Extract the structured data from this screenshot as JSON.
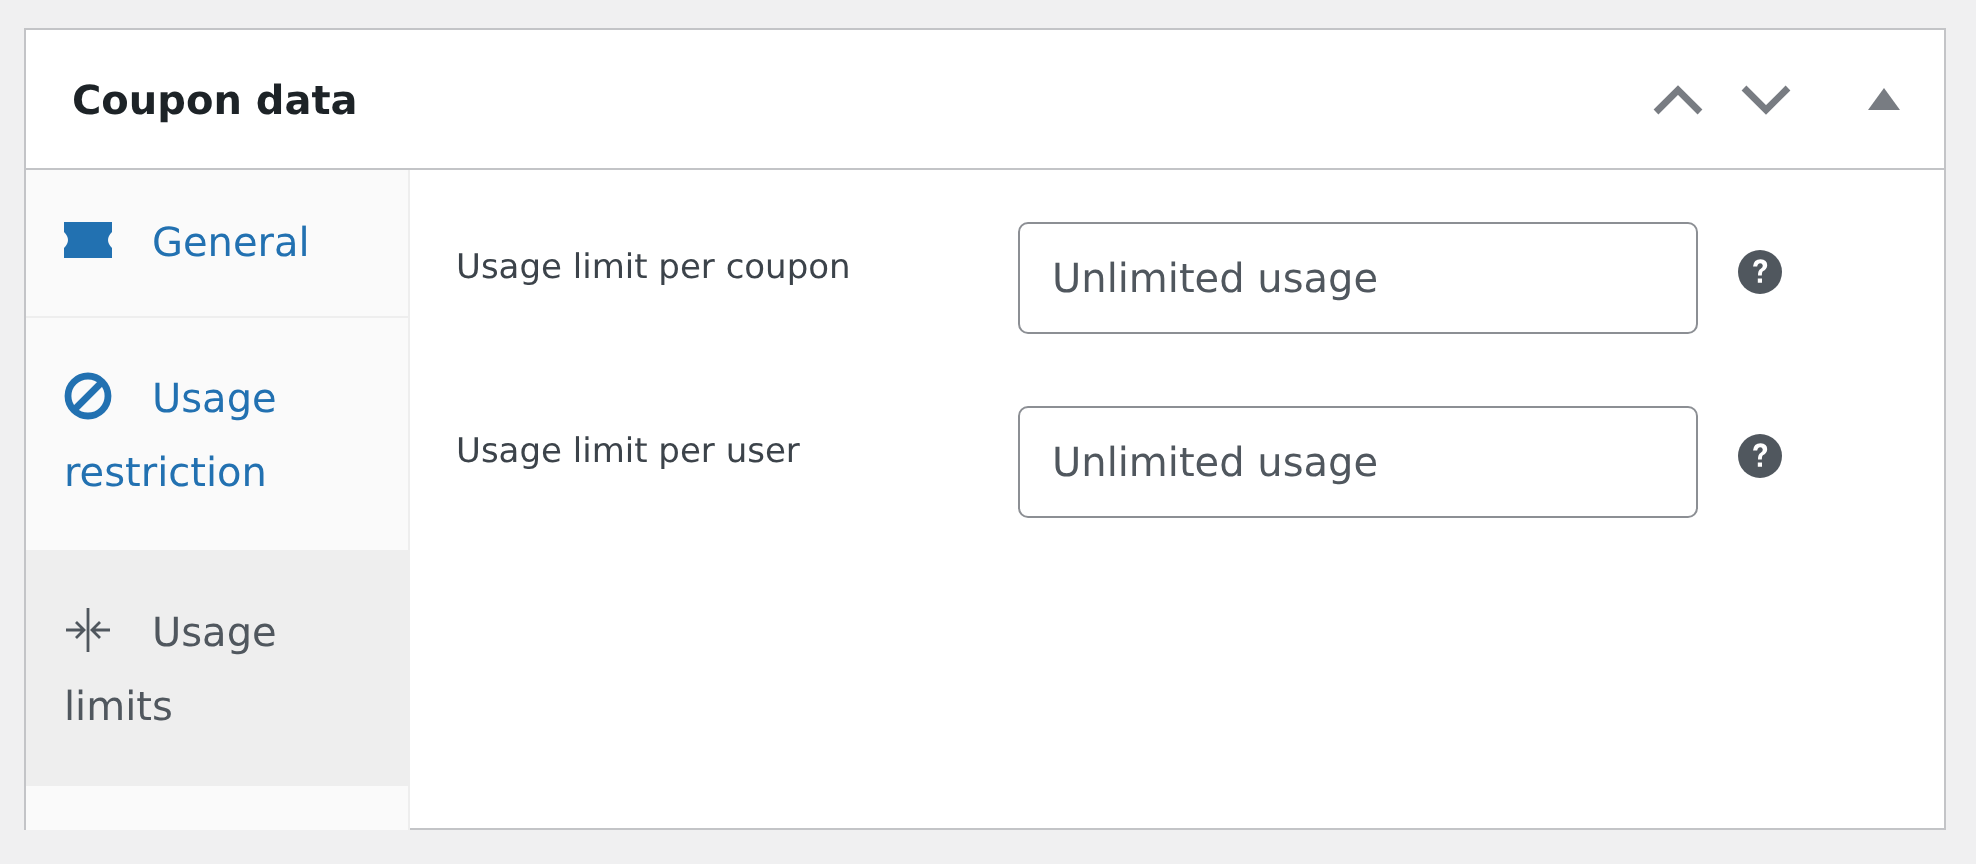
{
  "panel": {
    "title": "Coupon data"
  },
  "tabs": [
    {
      "label": "General",
      "selected": false
    },
    {
      "label": "Usage restriction",
      "selected": false
    },
    {
      "label": "Usage limits",
      "selected": true
    }
  ],
  "fields": [
    {
      "label": "Usage limit per coupon",
      "placeholder": "Unlimited usage"
    },
    {
      "label": "Usage limit per user",
      "placeholder": "Unlimited usage"
    }
  ]
}
